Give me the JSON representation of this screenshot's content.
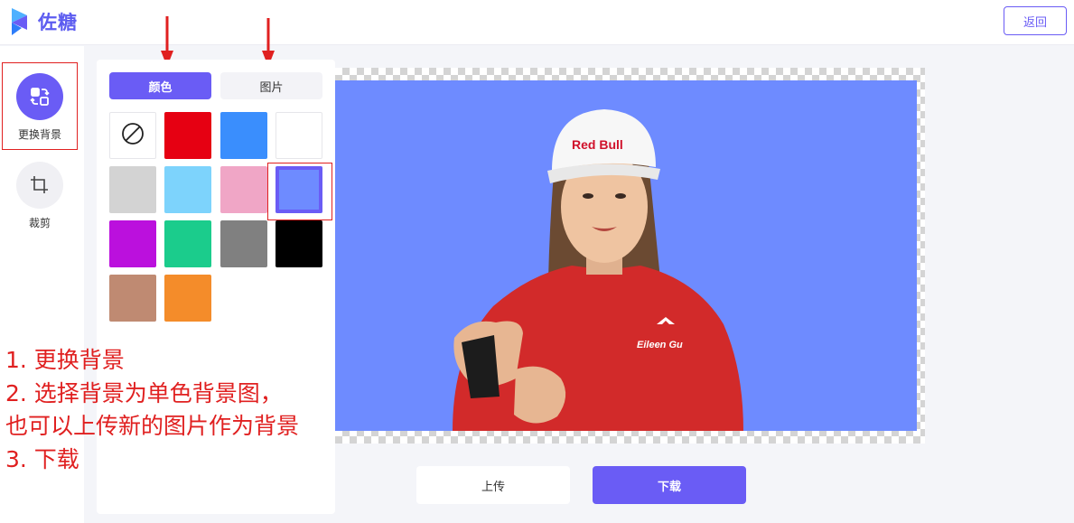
{
  "header": {
    "brand": "佐糖",
    "back_label": "返回"
  },
  "sidebar": {
    "items": [
      {
        "label": "更换背景",
        "icon": "swap-image-icon",
        "active": true
      },
      {
        "label": "裁剪",
        "icon": "crop-icon",
        "active": false
      }
    ]
  },
  "panel": {
    "tabs": [
      {
        "label": "颜色",
        "active": true
      },
      {
        "label": "图片",
        "active": false
      }
    ],
    "swatches": [
      {
        "color": "none",
        "icon": "no-color-icon"
      },
      {
        "color": "#e60012"
      },
      {
        "color": "#3a8efd"
      },
      {
        "color": "#ffffff"
      },
      {
        "color": "#d3d3d3"
      },
      {
        "color": "#7dd3fc"
      },
      {
        "color": "#f0a6c6"
      },
      {
        "color": "#6e8bff",
        "selected": true
      },
      {
        "color": "#bb10dd"
      },
      {
        "color": "#1bcc8c"
      },
      {
        "color": "#808080"
      },
      {
        "color": "#000000"
      },
      {
        "color": "#bf8a72"
      },
      {
        "color": "#f48c2a"
      }
    ]
  },
  "canvas": {
    "background_color": "#6e8bff",
    "subject_text": {
      "cap_logo": "Red Bull",
      "jacket_name": "Eileen Gu"
    }
  },
  "actions": {
    "upload_label": "上传",
    "download_label": "下载"
  },
  "annotation": {
    "lines": [
      "1. 更换背景",
      "2. 选择背景为单色背景图，",
      "也可以上传新的图片作为背景",
      "3. 下载"
    ]
  },
  "colors": {
    "accent": "#6a5cf5",
    "annotation_red": "#e02020"
  }
}
